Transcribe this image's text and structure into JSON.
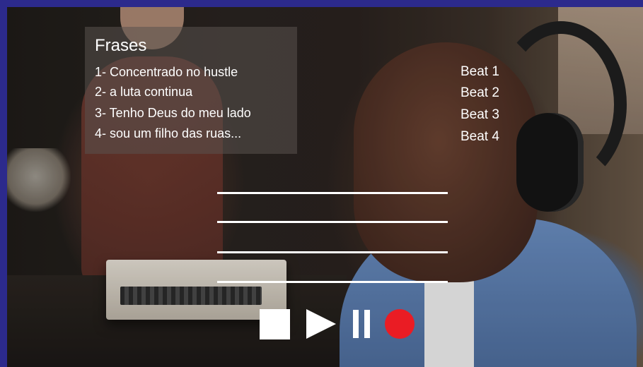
{
  "panel": {
    "title": "Frases",
    "phrases": [
      "1- Concentrado no hustle",
      "2- a luta continua",
      "3- Tenho Deus do meu lado",
      "4- sou um filho das ruas..."
    ],
    "beats": [
      "Beat 1",
      "Beat 2",
      "Beat 3",
      "Beat 4"
    ]
  },
  "controls": {
    "stop_icon": "stop-icon",
    "play_icon": "play-icon",
    "pause_icon": "pause-icon",
    "record_icon": "record-icon"
  },
  "colors": {
    "frame": "#2c2a8c",
    "record": "#ea1c24",
    "text": "#ffffff"
  }
}
